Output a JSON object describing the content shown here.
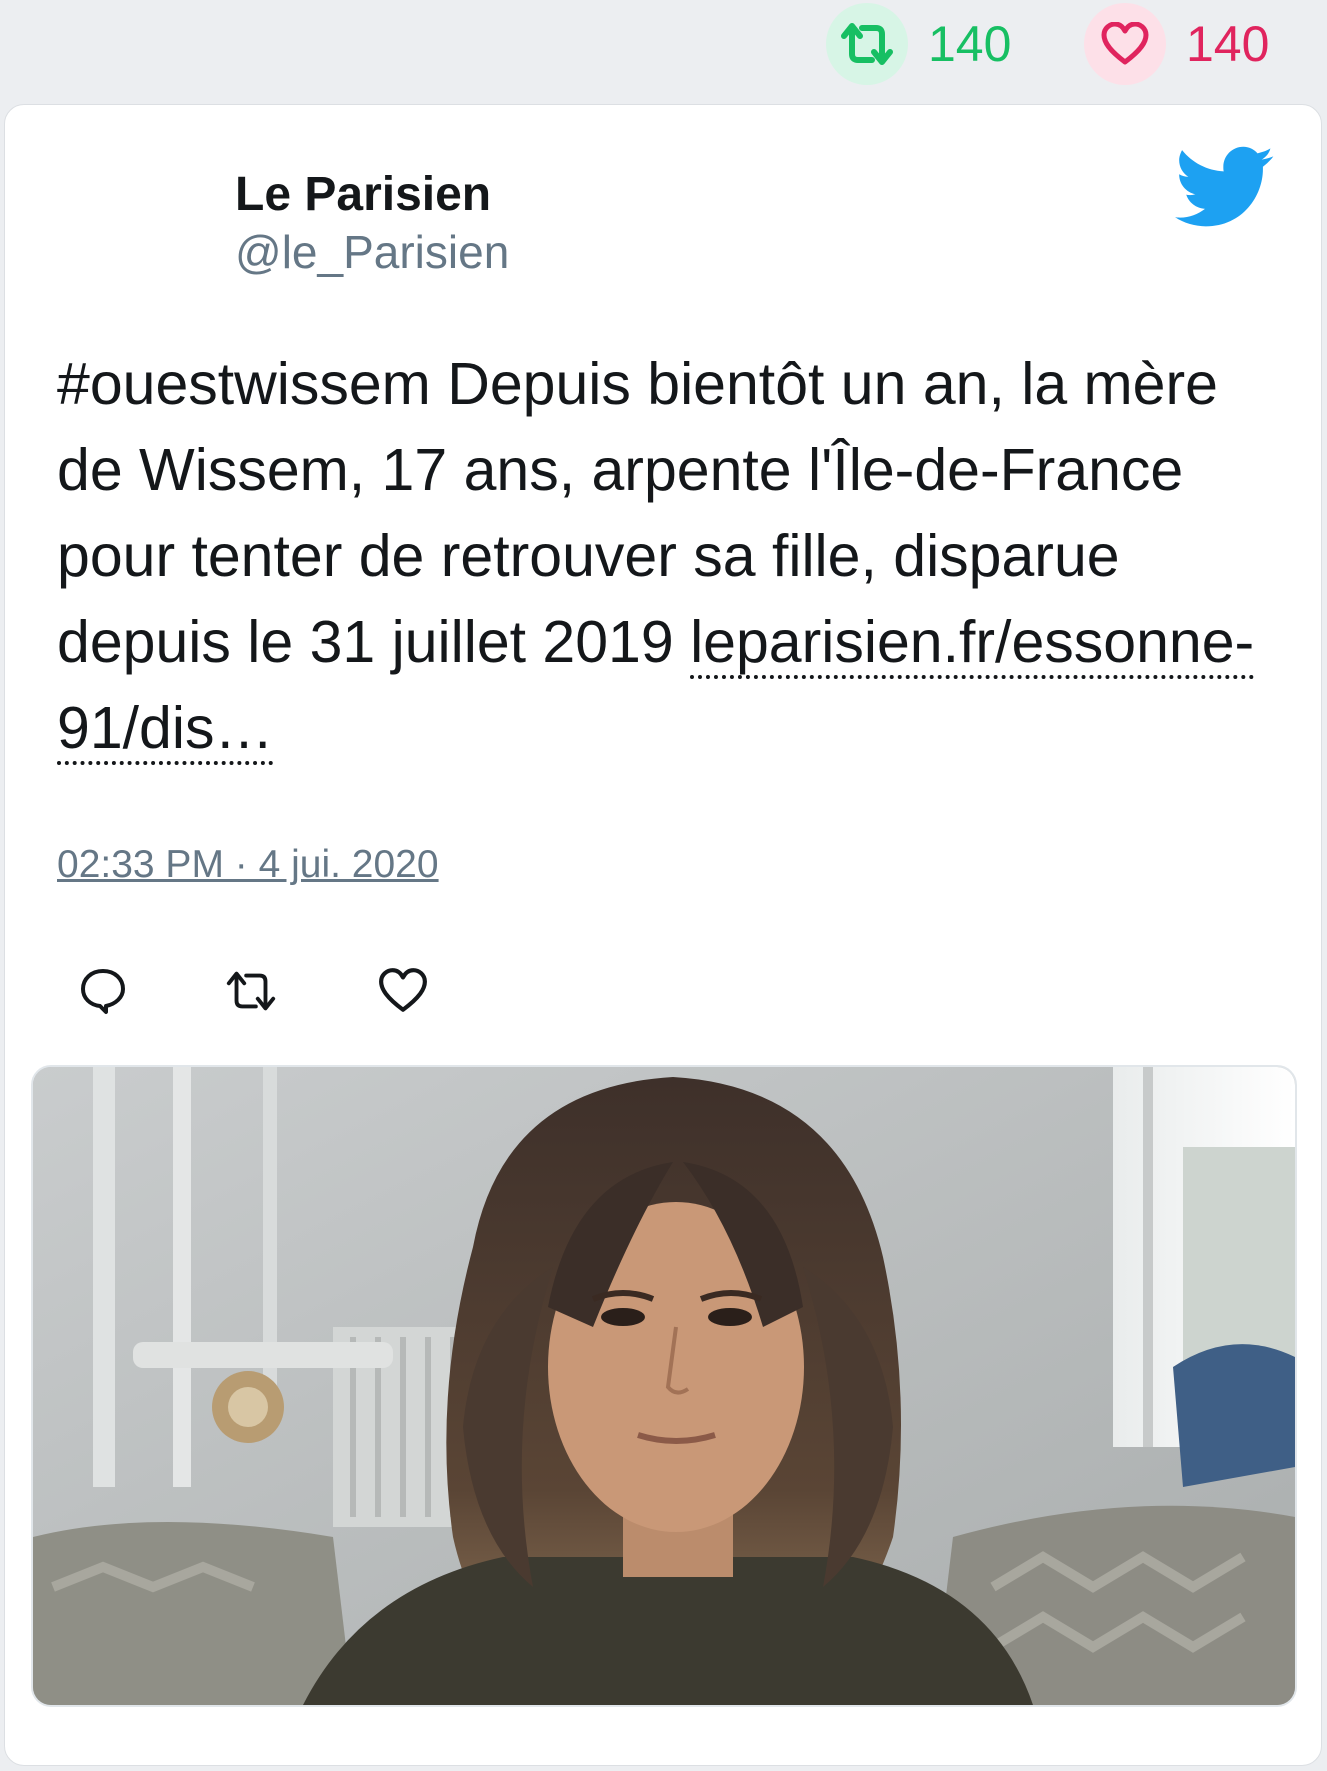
{
  "stats": {
    "retweets": "140",
    "likes": "140",
    "retweet_color": "#17bf63",
    "like_color": "#e0245e"
  },
  "tweet": {
    "author_name": "Le Parisien",
    "author_handle": "@le_Parisien",
    "text": "#ouestwissem Depuis bientôt un an, la mère de Wissem, 17 ans, arpente l'Île-de-France pour tenter de retrouver sa fille, disparue depuis le 31 juillet 2019 ",
    "link_text": "leparisien.fr/essonne-91/dis…",
    "timestamp": "02:33 PM · 4 jui. 2020"
  },
  "icons": {
    "brand": "twitter-bird-icon",
    "reply": "reply-icon",
    "retweet": "retweet-icon",
    "like": "heart-icon",
    "brand_color": "#1da1f2"
  }
}
